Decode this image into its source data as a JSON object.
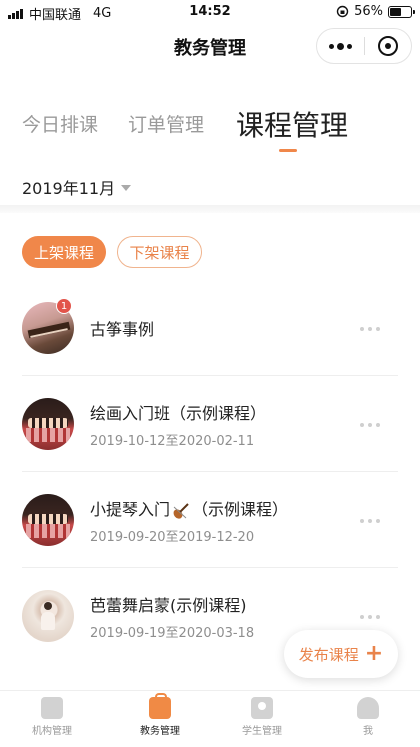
{
  "status_bar": {
    "carrier": "中国联通",
    "network": "4G",
    "time": "14:52",
    "battery": "56%",
    "battery_level": 0.56
  },
  "nav": {
    "title": "教务管理"
  },
  "tabs": [
    {
      "label": "今日排课"
    },
    {
      "label": "订单管理"
    },
    {
      "label": "课程管理"
    }
  ],
  "active_tab": 2,
  "month_selector": "2019年11月",
  "filters": {
    "on_shelf": "上架课程",
    "off_shelf": "下架课程"
  },
  "courses": [
    {
      "title": "古筝事例",
      "dates": "",
      "badge": "1"
    },
    {
      "title": "绘画入门班（示例课程）",
      "dates": "2019-10-12至2020-02-11"
    },
    {
      "title_before": "小提琴入门",
      "title_after": "（示例课程）",
      "dates": "2019-09-20至2019-12-20",
      "title_icon": "violin-icon"
    },
    {
      "title": "芭蕾舞启蒙(示例课程)",
      "dates": "2019-09-19至2020-03-18"
    }
  ],
  "publish_button": "发布课程",
  "tab_bar": [
    {
      "label": "机构管理",
      "icon": "building-icon"
    },
    {
      "label": "教务管理",
      "icon": "bag-icon"
    },
    {
      "label": "学生管理",
      "icon": "id-card-icon"
    },
    {
      "label": "我",
      "icon": "user-icon"
    }
  ],
  "colors": {
    "accent": "#f0874a",
    "badge": "#e2544a",
    "muted_text": "#9a9a9a"
  }
}
